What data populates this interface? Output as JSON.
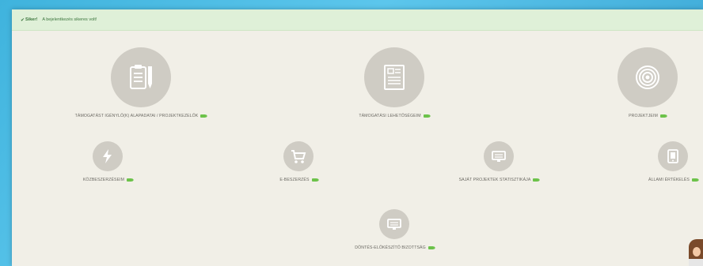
{
  "alert": {
    "icon": "check-icon",
    "strong": "Siker!",
    "message": "A bejelentkezés sikeres volt!"
  },
  "tiles": [
    {
      "label": "Támogatást igénylő(k) alapadatai / Projektkezelők",
      "icon": "clipboard-pencil-icon"
    },
    {
      "label": "Támogatási lehetőségeim",
      "icon": "document-icon"
    },
    {
      "label": "Projektjeim",
      "icon": "target-icon"
    },
    {
      "label": "Közbeszerzéseim",
      "icon": "lightning-icon"
    },
    {
      "label": "E-beszerzés",
      "icon": "cart-icon"
    },
    {
      "label": "Saját projektek statisztikája",
      "icon": "monitor-icon"
    },
    {
      "label": "Állami értékelés",
      "icon": "tablet-icon"
    },
    {
      "label": "Döntés-előkészítő bizottság",
      "icon": "monitor-icon"
    }
  ],
  "colors": {
    "accent_green": "#6cc24a",
    "alert_bg": "#dff0d8",
    "page_bg": "#f1efe7",
    "circle_bg": "#cfccc4"
  }
}
